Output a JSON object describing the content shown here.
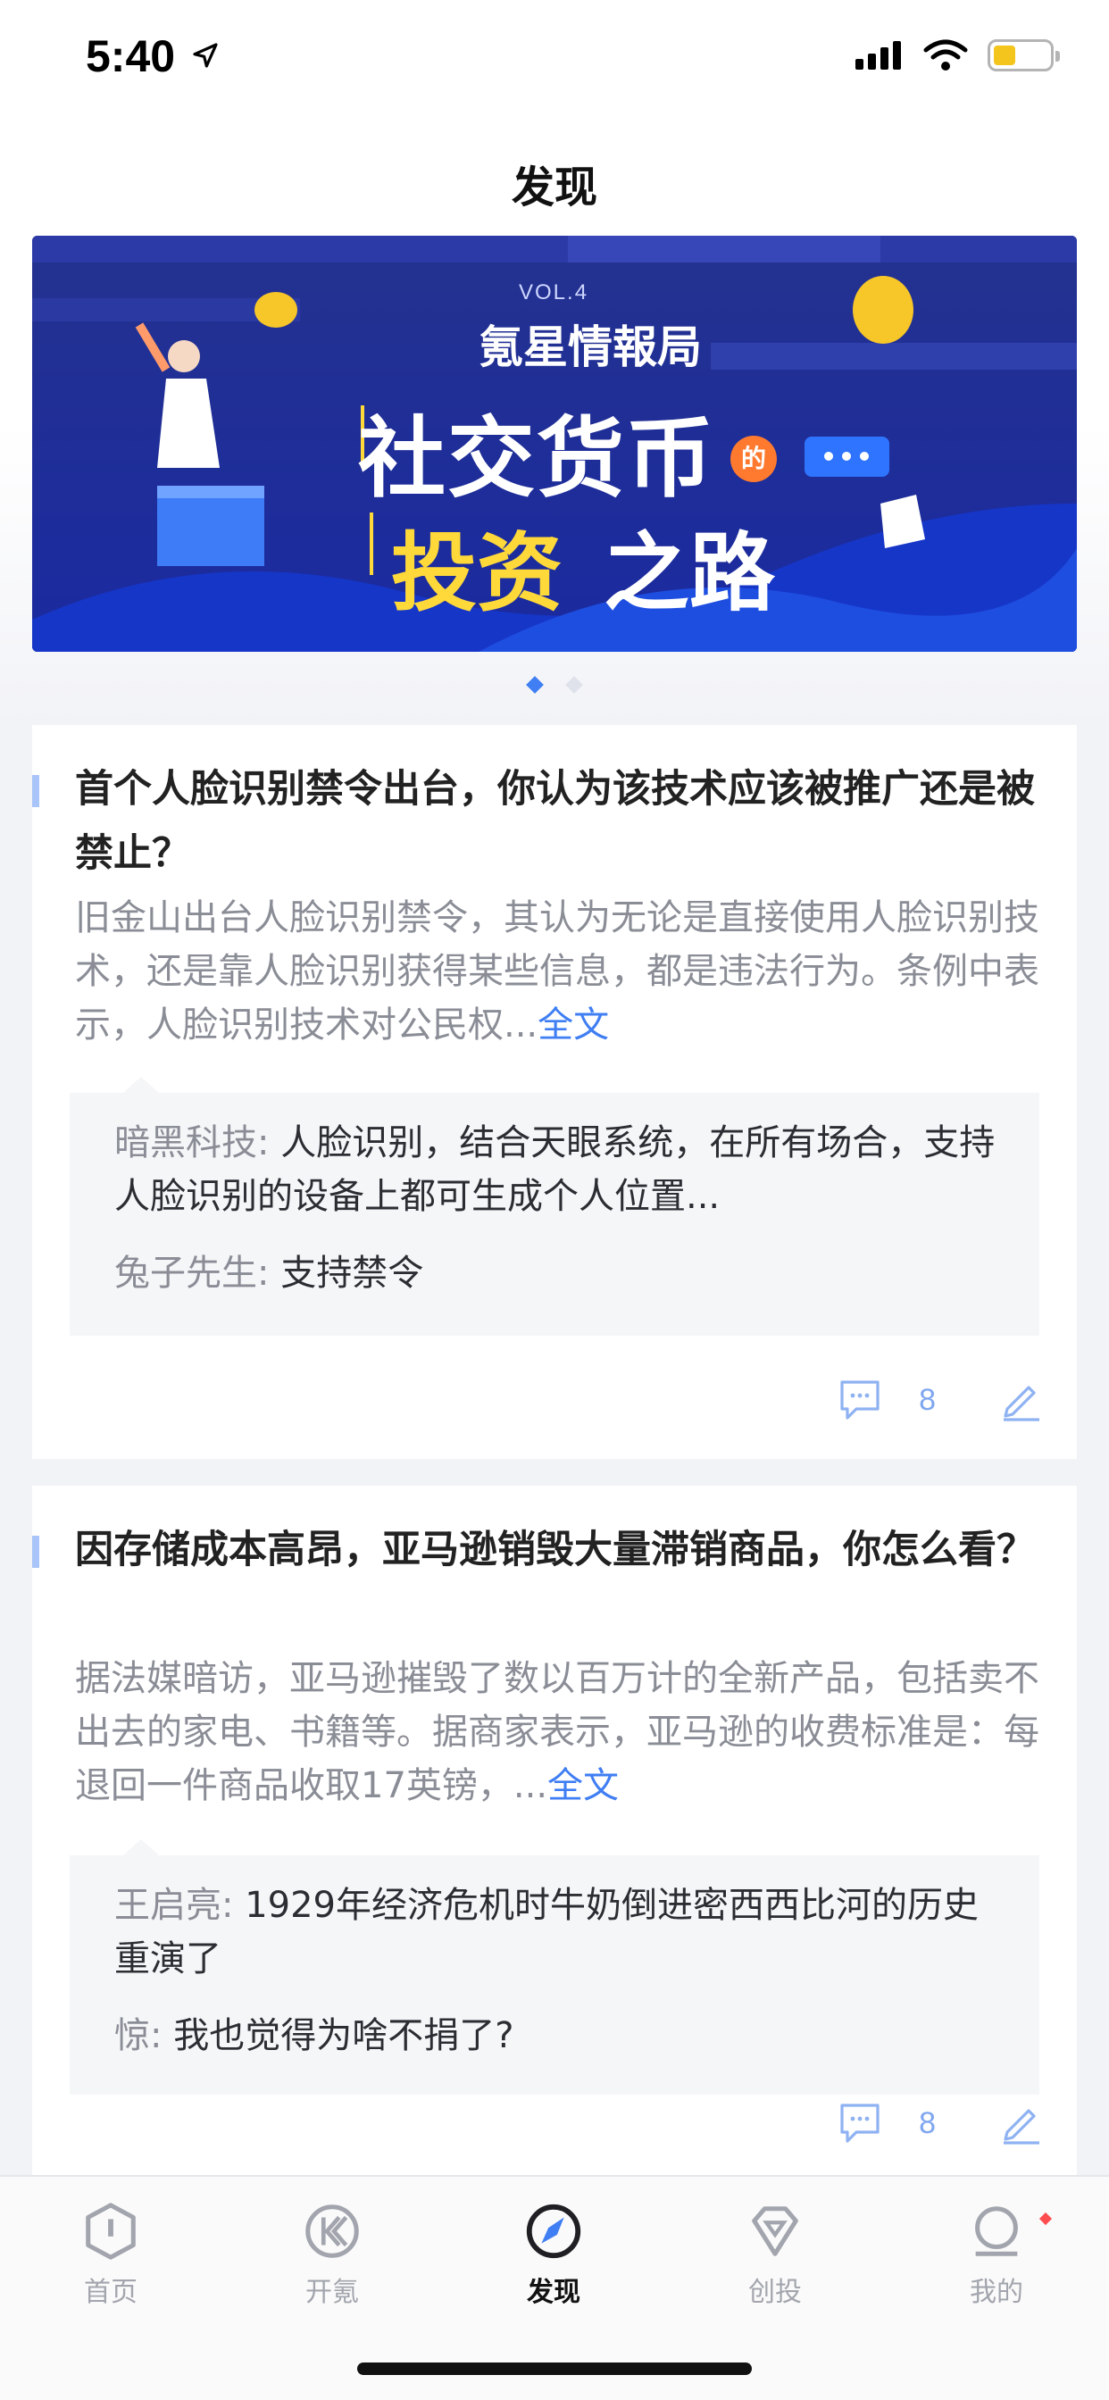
{
  "status_bar": {
    "time": "5:40",
    "icons": [
      "location-arrow-icon",
      "cellular-signal-icon",
      "wifi-icon",
      "battery-icon"
    ]
  },
  "header": {
    "title": "发现"
  },
  "banner": {
    "vol": "VOL.4",
    "brand": "氪星情報局",
    "headline_line1": "社交货币",
    "headline_tag": "的",
    "headline_line2_a": "投资",
    "headline_line2_b": "之路",
    "pager": {
      "count": 2,
      "active_index": 0
    }
  },
  "cards": [
    {
      "title": "首个人脸识别禁令出台，你认为该技术应该被推广还是被禁止？",
      "excerpt": "旧金山出台人脸识别禁令，其认为无论是直接使用人脸识别技术，还是靠人脸识别获得某些信息，都是违法行为。条例中表示，人脸识别技术对公民权...",
      "read_more": "全文",
      "comments": [
        {
          "user": "暗黑科技: ",
          "text": "人脸识别，结合天眼系统，在所有场合，支持人脸识别的设备上都可生成个人位置..."
        },
        {
          "user": "兔子先生: ",
          "text": "支持禁令"
        }
      ],
      "comment_count": "8"
    },
    {
      "title": "因存储成本高昂，亚马逊销毁大量滞销商品，你怎么看？",
      "excerpt": "据法媒暗访，亚马逊摧毁了数以百万计的全新产品，包括卖不出去的家电、书籍等。据商家表示，亚马逊的收费标准是：每退回一件商品收取17英镑，...",
      "read_more": "全文",
      "comments": [
        {
          "user": "王启亮: ",
          "text": "1929年经济危机时牛奶倒进密西西比河的历史重演了"
        },
        {
          "user": "惊: ",
          "text": "我也觉得为啥不捐了?"
        }
      ],
      "comment_count": "8"
    }
  ],
  "tab_bar": {
    "tabs": [
      {
        "label": "首页",
        "icon": "home-shield-icon",
        "active": false
      },
      {
        "label": "开氪",
        "icon": "kaike-icon",
        "active": false
      },
      {
        "label": "发现",
        "icon": "compass-icon",
        "active": true
      },
      {
        "label": "创投",
        "icon": "diamond-icon",
        "active": false
      },
      {
        "label": "我的",
        "icon": "profile-icon",
        "active": false
      }
    ]
  },
  "colors": {
    "accent": "#3f7ef3",
    "banner_bg": "#1c2a8c",
    "headline_yellow": "#ffd93a"
  }
}
